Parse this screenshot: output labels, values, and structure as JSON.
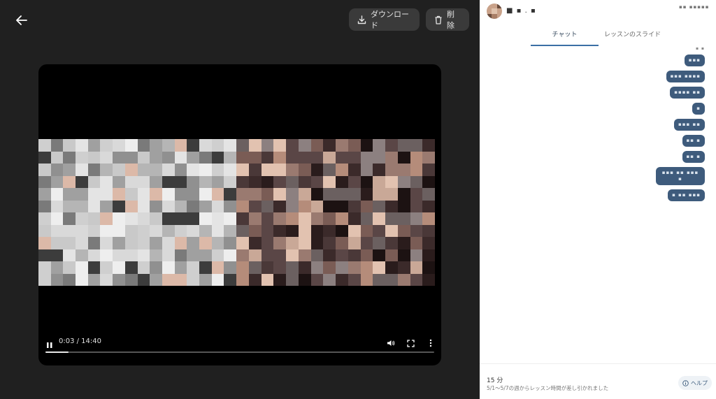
{
  "toolbar": {
    "download_label": "ダウンロード",
    "delete_label": "削除"
  },
  "player": {
    "time_display": "0:03 / 14:40",
    "progress_fraction": 0.06
  },
  "sidebar": {
    "teacher_name": "■ ▪ . ▪",
    "meta_text": "▪▪ ▪▪▪▪▪",
    "tabs": [
      {
        "label": "チャット",
        "active": true
      },
      {
        "label": "レッスンのスライド",
        "active": false
      }
    ],
    "chat": {
      "time": "▪ ▪",
      "messages": [
        "▪▪▪",
        "▪▪▪ ▪▪▪▪",
        "▪▪▪▪ ▪▪",
        "▪",
        "▪▪▪ ▪▪",
        "▪▪ ▪",
        "▪▪ ▪",
        "▪▪▪ ▪▪ ▪▪▪ ▪",
        "▪ ▪▪ ▪▪▪"
      ]
    },
    "footer": {
      "duration": "15 分",
      "notice": "5/1～5/7の週からレッスン時間が差し引かれました",
      "help_label": "ヘルプ"
    }
  },
  "colors": {
    "accent": "#3b6fa5",
    "bubble": "#3e5b7c",
    "dark_bg": "#202020"
  }
}
